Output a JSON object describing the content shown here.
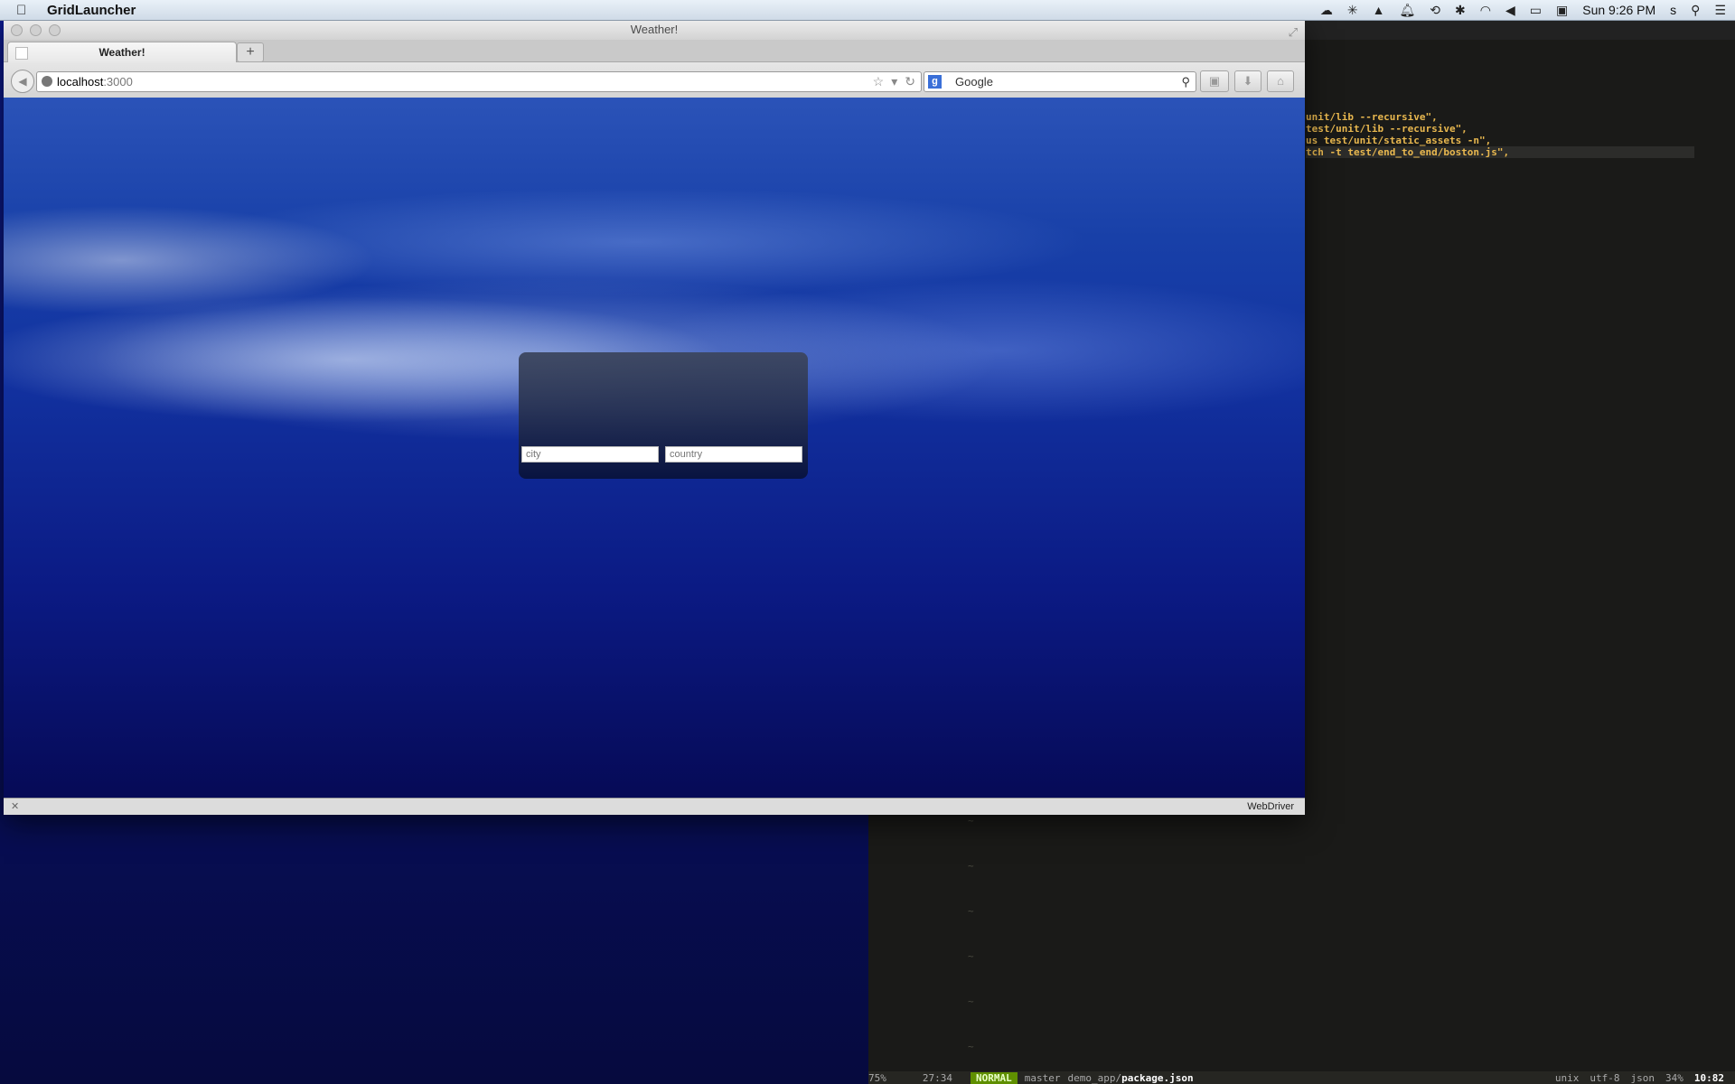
{
  "menubar": {
    "app_name": "GridLauncher",
    "clock": "Sun 9:26 PM",
    "user_initial": "s",
    "status_icons": [
      "cloud-icon",
      "asterisk-icon",
      "drive-icon",
      "bell-icon",
      "time-machine-icon",
      "bluetooth-icon",
      "wifi-icon",
      "volume-icon",
      "battery-icon",
      "display-icon"
    ]
  },
  "browser": {
    "window_title": "Weather!",
    "tab_title": "Weather!",
    "url_host": "localhost",
    "url_port": ":3000",
    "search_engine": "Google",
    "addon_bar_label": "WebDriver"
  },
  "weather_form": {
    "city_placeholder": "city",
    "country_placeholder": "country"
  },
  "terminal": {
    "code_lines": [
      "unit/lib --recursive\",",
      "test/unit/lib --recursive\",",
      "us test/unit/static_assets -n\",",
      "tch -t test/end_to_end/boston.js\","
    ],
    "status": {
      "left_percent": "75%",
      "position": "27:34",
      "mode": "NORMAL",
      "branch": "master",
      "path_dir": "demo_app/",
      "path_file": "package.json",
      "fileformat": "unix",
      "encoding": "utf-8",
      "filetype": "json",
      "percent": "34%",
      "cursor": "10:82"
    }
  }
}
